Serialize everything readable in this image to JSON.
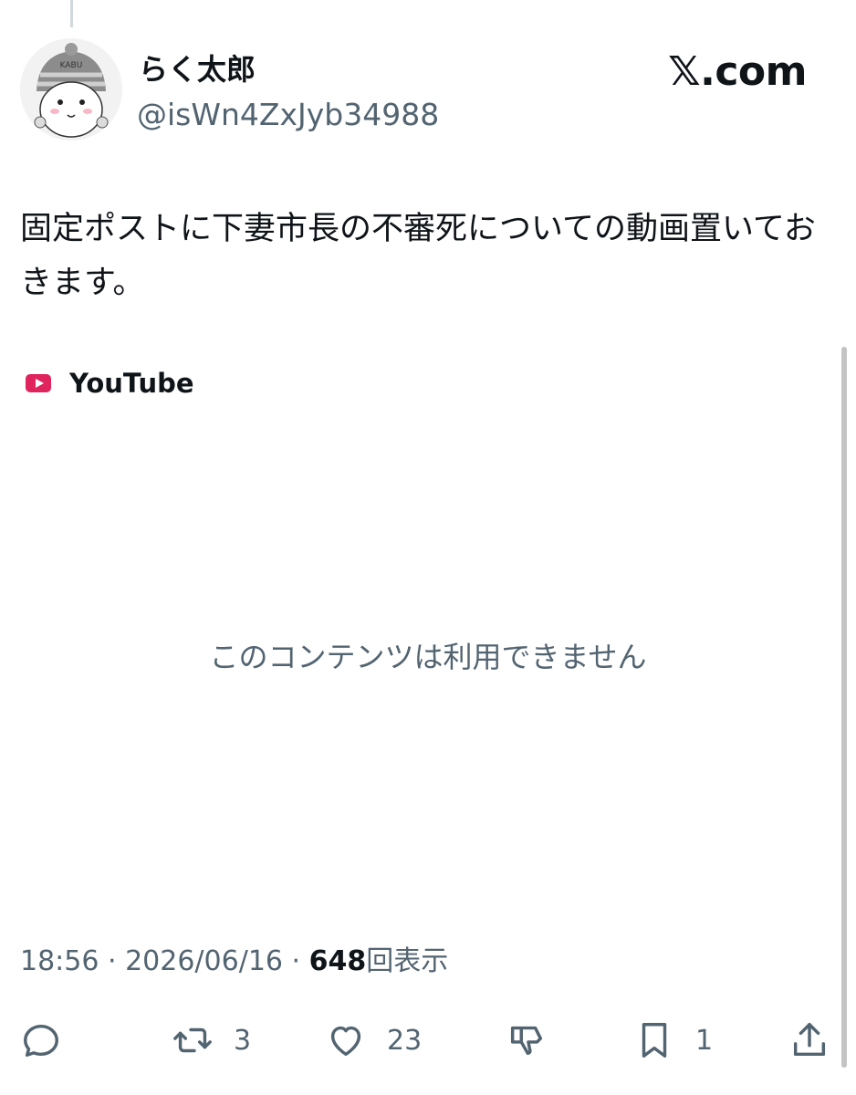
{
  "author": {
    "display_name": "らく太郎",
    "handle": "@isWn4ZxJyb34988",
    "avatar_icon": "avatar-character-icon",
    "avatar_hat_text": "KABU"
  },
  "brand": "𝕏.com",
  "post": {
    "text": "固定ポストに下妻市長の不審死についての動画置いておきます。"
  },
  "card": {
    "source_icon": "youtube-icon",
    "source_label": "YouTube",
    "unavailable_text": "このコンテンツは利用できません"
  },
  "meta": {
    "time": "18:56",
    "separator": " · ",
    "date": "2026/06/16",
    "views_count": "648",
    "views_label": "回表示"
  },
  "actions": {
    "reply_icon": "reply-icon",
    "reply_count": "",
    "repost_icon": "repost-icon",
    "repost_count": "3",
    "like_icon": "heart-icon",
    "like_count": "23",
    "downvote_icon": "downvote-icon",
    "bookmark_icon": "bookmark-icon",
    "bookmark_count": "1",
    "share_icon": "share-icon"
  },
  "colors": {
    "text_primary": "#0f1419",
    "text_secondary": "#536471",
    "youtube_red": "#e0245e",
    "thread_line": "#cfd9de"
  }
}
